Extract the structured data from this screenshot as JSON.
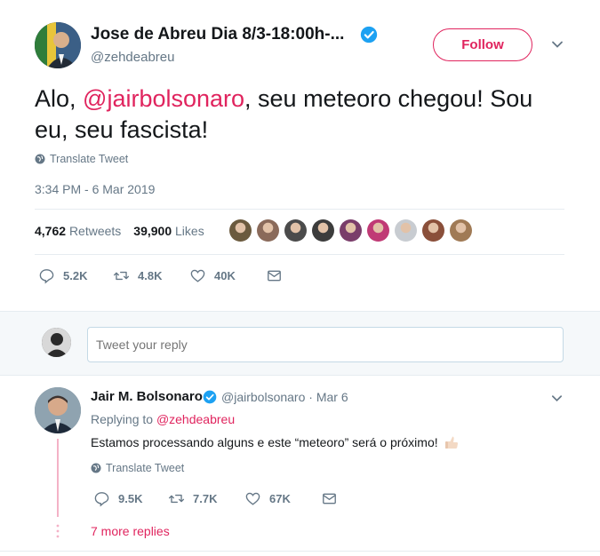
{
  "tweet": {
    "author_name": "Jose de Abreu Dia 8/3-18:00h-...",
    "author_handle": "@zehdeabreu",
    "follow_label": "Follow",
    "text_before": "Alo, ",
    "mention": "@jairbolsonaro",
    "text_after": ", seu meteoro chegou! Sou eu, seu fascista!",
    "translate_label": "Translate Tweet",
    "timestamp": "3:34 PM - 6 Mar 2019",
    "retweets_count": "4,762",
    "retweets_label": "Retweets",
    "likes_count": "39,900",
    "likes_label": "Likes",
    "liker_faces": [
      "#6b5a3e",
      "#8a6a5a",
      "#4b4b4b",
      "#3c3c3c",
      "#7a3d6a",
      "#c03a75",
      "#c8ccd1",
      "#8a4f3a",
      "#a07a55"
    ],
    "actions": {
      "replies": "5.2K",
      "retweets": "4.8K",
      "likes": "40K"
    }
  },
  "reply_box": {
    "placeholder": "Tweet your reply"
  },
  "reply": {
    "author_name": "Jair M. Bolsonaro",
    "author_handle": "@jairbolsonaro",
    "date": "· Mar 6",
    "replying_prefix": "Replying to ",
    "replying_to": "@zehdeabreu",
    "text": "Estamos processando alguns e este “meteoro” será o próximo!",
    "translate_label": "Translate Tweet",
    "actions": {
      "replies": "9.5K",
      "retweets": "7.7K",
      "likes": "67K"
    },
    "more_replies": "7 more replies"
  },
  "colors": {
    "accent": "#e0245e",
    "verified": "#1da1f2",
    "muted": "#657786",
    "text": "#14171a"
  }
}
